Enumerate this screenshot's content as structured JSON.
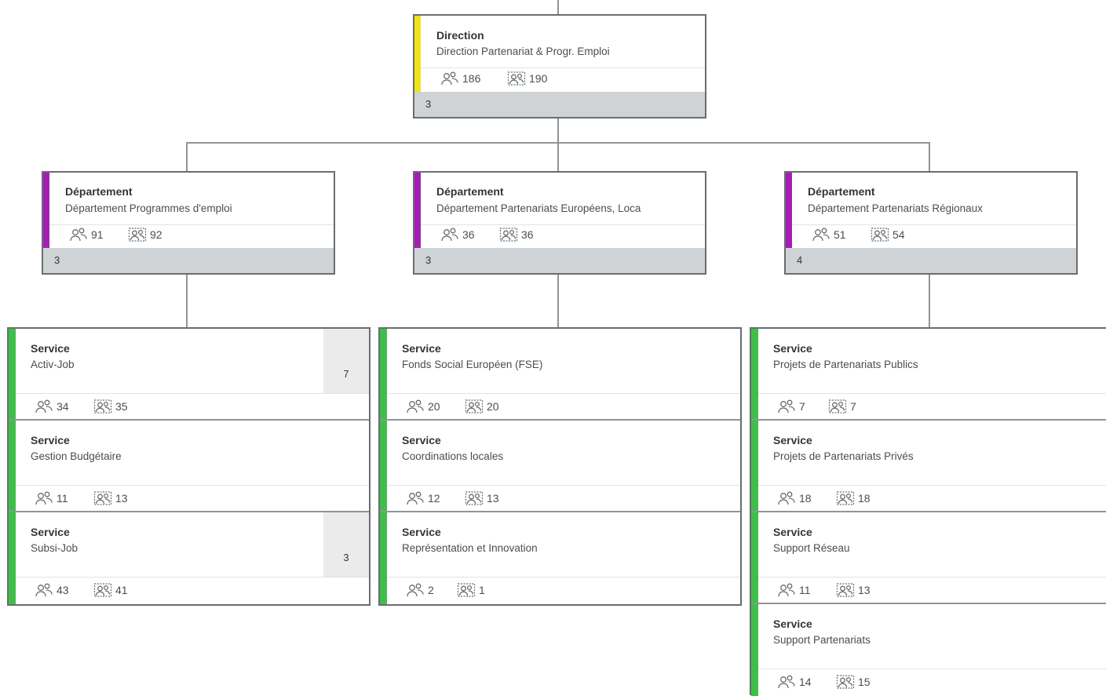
{
  "colors": {
    "direction_accent": "#f0e31a",
    "department_accent": "#a51eb4",
    "service_accent": "#3fbe4a",
    "count_bar": "#cfd3d6"
  },
  "icons": {
    "headcount": "people-icon",
    "positions": "positions-icon"
  },
  "direction": {
    "type": "Direction",
    "name": "Direction Partenariat & Progr. Emploi",
    "headcount": "186",
    "positions": "190",
    "count": "3"
  },
  "departments": [
    {
      "type": "Département",
      "name": "Département Programmes d'emploi",
      "headcount": "91",
      "positions": "92",
      "count": "3"
    },
    {
      "type": "Département",
      "name": "Département Partenariats Européens, Loca",
      "headcount": "36",
      "positions": "36",
      "count": "3"
    },
    {
      "type": "Département",
      "name": "Département Partenariats Régionaux",
      "headcount": "51",
      "positions": "54",
      "count": "4"
    }
  ],
  "services": [
    [
      {
        "type": "Service",
        "name": "Activ-Job",
        "headcount": "34",
        "positions": "35",
        "count": "7"
      },
      {
        "type": "Service",
        "name": "Gestion Budgétaire",
        "headcount": "11",
        "positions": "13"
      },
      {
        "type": "Service",
        "name": "Subsi-Job",
        "headcount": "43",
        "positions": "41",
        "count": "3"
      }
    ],
    [
      {
        "type": "Service",
        "name": "Fonds Social Européen (FSE)",
        "headcount": "20",
        "positions": "20"
      },
      {
        "type": "Service",
        "name": "Coordinations locales",
        "headcount": "12",
        "positions": "13"
      },
      {
        "type": "Service",
        "name": "Représentation et Innovation",
        "headcount": "2",
        "positions": "1"
      }
    ],
    [
      {
        "type": "Service",
        "name": "Projets de Partenariats Publics",
        "headcount": "7",
        "positions": "7"
      },
      {
        "type": "Service",
        "name": "Projets de Partenariats Privés",
        "headcount": "18",
        "positions": "18"
      },
      {
        "type": "Service",
        "name": "Support Réseau",
        "headcount": "11",
        "positions": "13"
      },
      {
        "type": "Service",
        "name": "Support Partenariats",
        "headcount": "14",
        "positions": "15"
      }
    ]
  ]
}
